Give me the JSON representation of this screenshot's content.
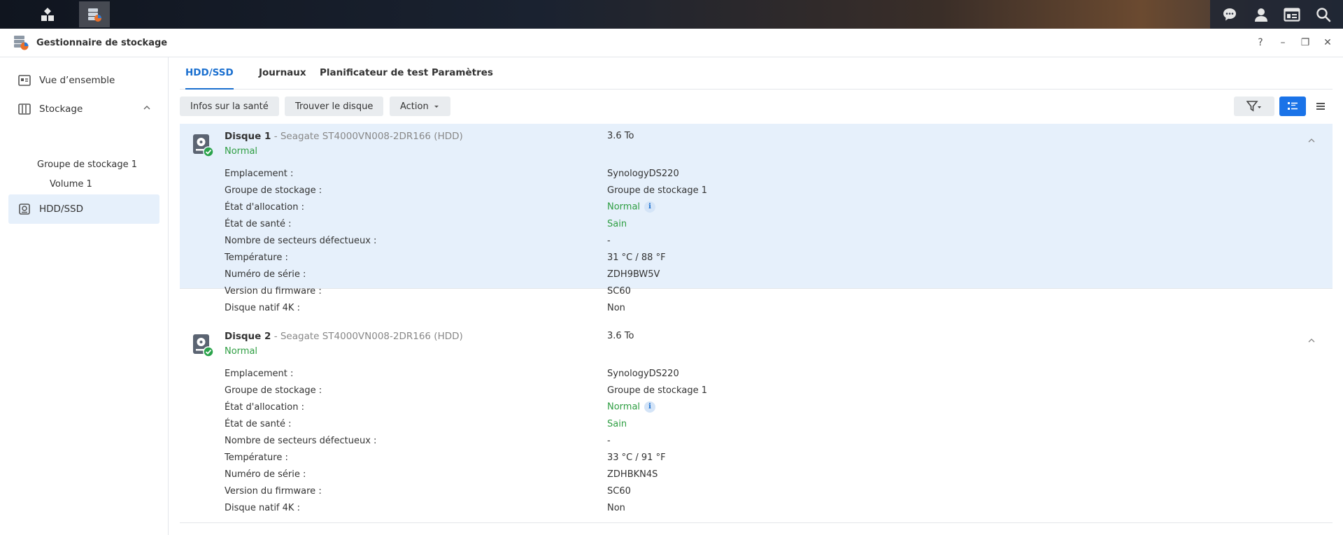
{
  "window": {
    "title": "Gestionnaire de stockage"
  },
  "window_controls": {
    "help": "?",
    "minimize": "–",
    "restore": "❐",
    "close": "✕"
  },
  "sidebar": {
    "overview": "Vue d’ensemble",
    "storage": "Stockage",
    "pool": "Groupe de stockage 1",
    "volume": "Volume 1",
    "hdd": "HDD/SSD"
  },
  "tabs": [
    "HDD/SSD",
    "Journaux",
    "Planificateur de test",
    "Paramètres"
  ],
  "toolbar": {
    "health": "Infos sur la santé",
    "find": "Trouver le disque",
    "action": "Action"
  },
  "labels": {
    "location": "Emplacement :",
    "pool": "Groupe de stockage :",
    "allocation": "État d'allocation :",
    "health": "État de santé :",
    "bad_sectors": "Nombre de secteurs défectueux :",
    "temperature": "Température :",
    "serial": "Numéro de série :",
    "firmware": "Version du firmware :",
    "native4k": "Disque natif 4K :"
  },
  "disks": [
    {
      "name": "Disque 1",
      "model": " - Seagate ST4000VN008-2DR166 (HDD)",
      "status": "Normal",
      "capacity": "3.6 To",
      "location": "SynologyDS220",
      "pool": "Groupe de stockage 1",
      "allocation": "Normal",
      "health": "Sain",
      "bad_sectors": "-",
      "temperature": "31 °C / 88 °F",
      "serial": "ZDH9BW5V",
      "firmware": "SC60",
      "native4k": "Non"
    },
    {
      "name": "Disque 2",
      "model": " - Seagate ST4000VN008-2DR166 (HDD)",
      "status": "Normal",
      "capacity": "3.6 To",
      "location": "SynologyDS220",
      "pool": "Groupe de stockage 1",
      "allocation": "Normal",
      "health": "Sain",
      "bad_sectors": "-",
      "temperature": "33 °C / 91 °F",
      "serial": "ZDHBKN4S",
      "firmware": "SC60",
      "native4k": "Non"
    }
  ],
  "colors": {
    "accent": "#1a6fcf",
    "ok": "#2e9e42",
    "selected_bg": "#e6f0fb"
  }
}
